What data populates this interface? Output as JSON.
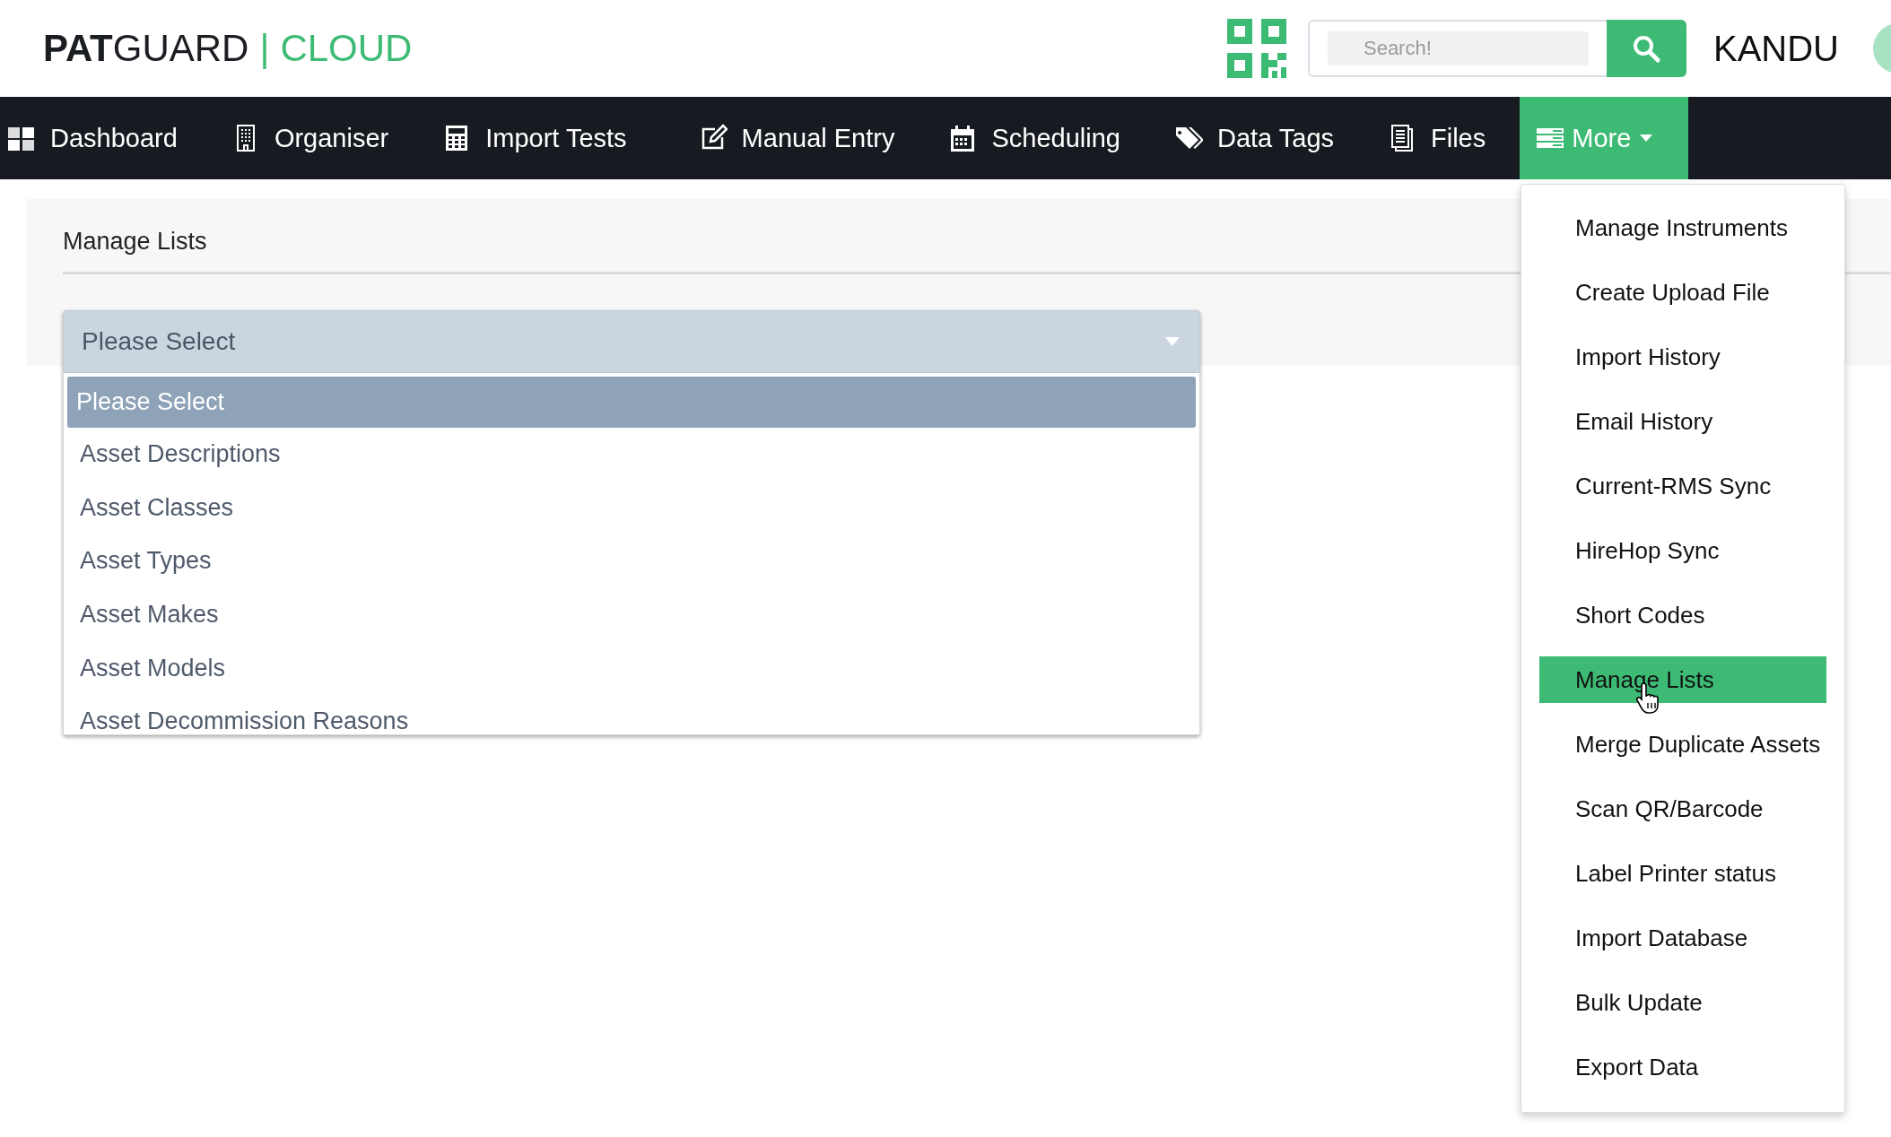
{
  "logo": {
    "bold": "PAT",
    "light": "GUARD",
    "separator": "|",
    "accent": "CLOUD"
  },
  "search": {
    "placeholder": "Search!"
  },
  "user": {
    "name": "KANDU"
  },
  "nav": [
    {
      "label": "Dashboard",
      "selected": false
    },
    {
      "label": "Organiser",
      "selected": false
    },
    {
      "label": "Import Tests",
      "selected": false
    },
    {
      "label": "Manual Entry",
      "selected": false
    },
    {
      "label": "Scheduling",
      "selected": false
    },
    {
      "label": "Data Tags",
      "selected": false
    },
    {
      "label": "Files",
      "selected": false
    },
    {
      "label": "More",
      "selected": true,
      "expanded": true
    }
  ],
  "page": {
    "title": "Manage Lists",
    "select": {
      "value": "Please Select",
      "expanded": true,
      "options": [
        {
          "label": "Please Select",
          "selected": true
        },
        {
          "label": "Asset Descriptions",
          "selected": false
        },
        {
          "label": "Asset Classes",
          "selected": false
        },
        {
          "label": "Asset Types",
          "selected": false
        },
        {
          "label": "Asset Makes",
          "selected": false
        },
        {
          "label": "Asset Models",
          "selected": false
        },
        {
          "label": "Asset Decommission Reasons",
          "selected": false
        }
      ]
    }
  },
  "more_menu": [
    {
      "label": "Manage Instruments",
      "selected": false
    },
    {
      "label": "Create Upload File",
      "selected": false
    },
    {
      "label": "Import History",
      "selected": false
    },
    {
      "label": "Email History",
      "selected": false
    },
    {
      "label": "Current-RMS Sync",
      "selected": false
    },
    {
      "label": "HireHop Sync",
      "selected": false
    },
    {
      "label": "Short Codes",
      "selected": false
    },
    {
      "label": "Manage Lists",
      "selected": true
    },
    {
      "label": "Merge Duplicate Assets",
      "selected": false
    },
    {
      "label": "Scan QR/Barcode",
      "selected": false
    },
    {
      "label": "Label Printer status",
      "selected": false
    },
    {
      "label": "Import Database",
      "selected": false
    },
    {
      "label": "Bulk Update",
      "selected": false
    },
    {
      "label": "Export Data",
      "selected": false
    }
  ]
}
